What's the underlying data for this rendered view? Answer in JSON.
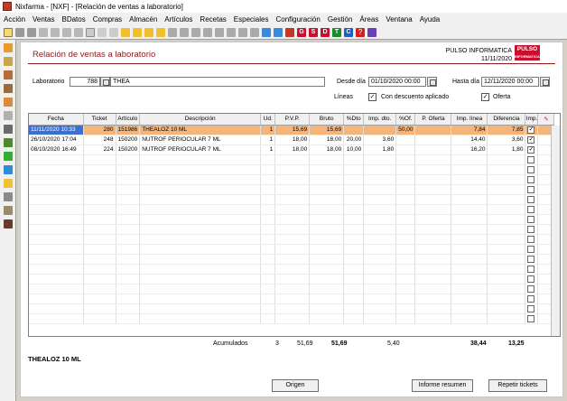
{
  "window": {
    "title": "Nixfarma - [NXF] - [Relación de ventas a laboratorio]"
  },
  "menu": [
    "Acción",
    "Ventas",
    "BDatos",
    "Compras",
    "Almacén",
    "Artículos",
    "Recetas",
    "Especiales",
    "Configuración",
    "Gestión",
    "Áreas",
    "Ventana",
    "Ayuda"
  ],
  "toolbar": {
    "letters": [
      "G",
      "S",
      "D",
      "T",
      "C"
    ]
  },
  "header": {
    "title": "Relación de ventas a laboratorio",
    "company": "PULSO INFORMATICA",
    "date": "11/11/2020",
    "logo": "PULSO",
    "logo_sub": "INFORMATICA"
  },
  "filters": {
    "laboratorio_label": "Laboratorio",
    "laboratorio_code": "788",
    "laboratorio_name": "THEA",
    "desde_label": "Desde día",
    "desde_value": "01/10/2020 00:00",
    "hasta_label": "Hasta día",
    "hasta_value": "12/11/2020 00:00",
    "lineas_label": "Líneas",
    "descuento_label": "Con descuento aplicado",
    "oferta_label": "Oferta"
  },
  "table": {
    "columns": [
      "Fecha",
      "Ticket",
      "Artículo",
      "Descripción",
      "Ud.",
      "P.V.P.",
      "Bruto",
      "%Dto",
      "Imp. dto.",
      "%Of.",
      "P. Oferta",
      "Imp. línea",
      "Diferencia",
      "Imp."
    ],
    "rows": [
      [
        "11/11/2020 10:33",
        "280",
        "151986",
        "THEALOZ 10 ML",
        "1",
        "15,69",
        "15,69",
        "",
        "",
        "50,00",
        "",
        "7,84",
        "7,85"
      ],
      [
        "26/10/2020 17:04",
        "248",
        "150200",
        "NUTROF PERIOCULAR 7 ML",
        "1",
        "18,00",
        "18,00",
        "20,00",
        "3,60",
        "",
        "",
        "14,40",
        "3,60"
      ],
      [
        "08/10/2020 16:49",
        "224",
        "150200",
        "NUTROF PERIOCULAR 7 ML",
        "1",
        "18,00",
        "18,00",
        "10,00",
        "1,80",
        "",
        "",
        "16,20",
        "1,80"
      ]
    ]
  },
  "totals": {
    "label": "Acumulados",
    "units": "3",
    "pvp": "51,69",
    "bruto": "51,69",
    "imp_dto": "5,40",
    "imp_linea": "38,44",
    "diferencia": "13,25"
  },
  "selected_product": "THEALOZ 10 ML",
  "buttons": {
    "origen": "Origen",
    "informe": "Informe resumen",
    "repetir": "Repetir tickets"
  }
}
